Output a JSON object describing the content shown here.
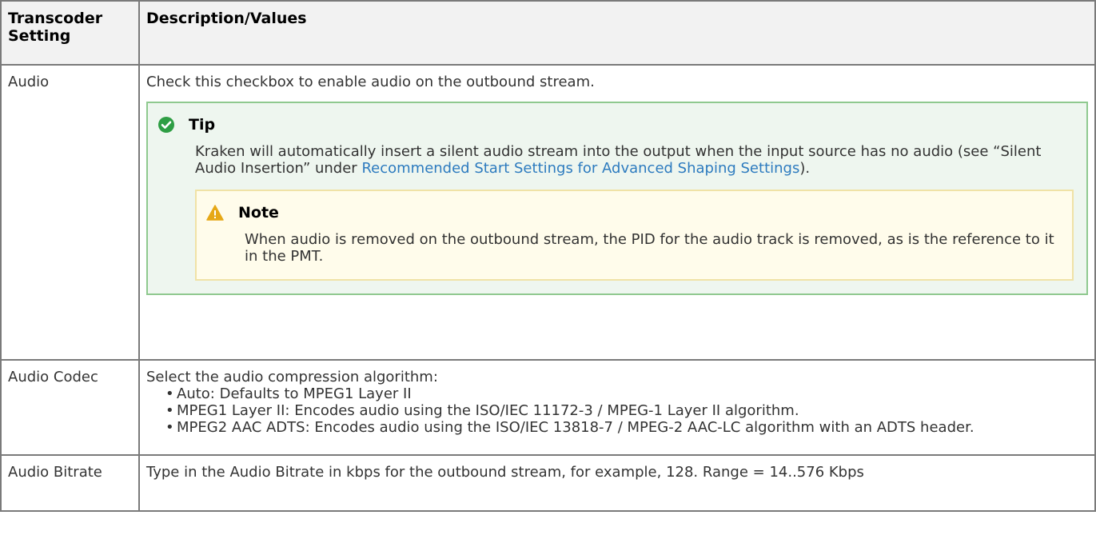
{
  "table": {
    "headers": [
      "Transcoder Setting",
      "Description/Values"
    ],
    "rows": {
      "audio": {
        "setting": "Audio",
        "description": "Check this checkbox to enable audio on the outbound stream.",
        "tip": {
          "title": "Tip",
          "icon": "check-circle-icon",
          "text_before": "Kraken will automatically insert a silent audio stream into the output when the input source has no audio (see “Silent Audio Insertion” under ",
          "link": "Recommended Start Settings for Advanced Shaping Settings",
          "text_after": ").",
          "note": {
            "title": "Note",
            "icon": "warning-icon",
            "text": "When audio is removed on the outbound stream, the PID for the audio track is removed, as is the reference to it in the PMT."
          }
        }
      },
      "codec": {
        "setting": "Audio Codec",
        "description": "Select the audio compression algorithm:",
        "items": [
          "Auto: Defaults to MPEG1 Layer II",
          "MPEG1 Layer II: Encodes audio using the ISO/IEC 11172-3 / MPEG-1 Layer II algorithm.",
          "MPEG2 AAC ADTS: Encodes audio using the ISO/IEC 13818-7 / MPEG-2 AAC-LC algorithm with an ADTS header."
        ]
      },
      "bitrate": {
        "setting": "Audio Bitrate",
        "description": "Type in the Audio Bitrate in kbps for the outbound stream, for example, 128. Range = 14..576 Kbps"
      }
    }
  },
  "colors": {
    "link": "#2d7bbf",
    "tip_border": "#8fc98f",
    "tip_background": "#eef6ef",
    "tip_icon": "#2e9e44",
    "note_border": "#f0e2a6",
    "note_background": "#fffceb",
    "note_icon": "#e6a817"
  }
}
